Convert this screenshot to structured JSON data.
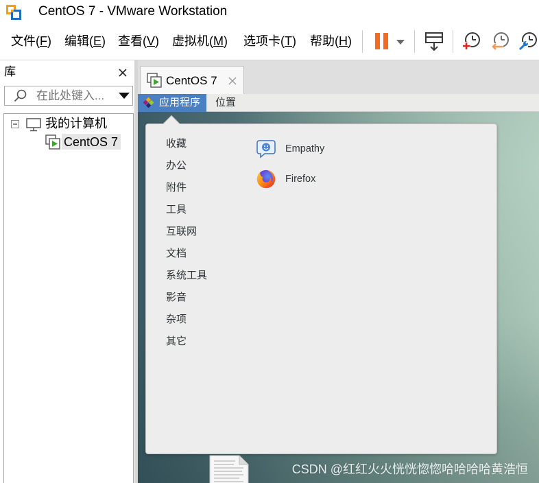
{
  "window": {
    "title": "CentOS 7 - VMware Workstation",
    "logo_icon": "vmware-workstation-logo-icon"
  },
  "menubar": {
    "items": [
      "文件(F)",
      "编辑(E)",
      "查看(V)",
      "虚拟机(M)",
      "选项卡(T)",
      "帮助(H)"
    ]
  },
  "toolbar": {
    "buttons": [
      {
        "icon": "pause-icon",
        "color": "#f26b21"
      },
      {
        "icon": "chevron-down-icon"
      },
      {
        "icon": "send-ctrl-alt-del-icon"
      },
      {
        "icon": "take-snapshot-icon"
      },
      {
        "icon": "revert-snapshot-icon"
      },
      {
        "icon": "snapshot-manager-icon"
      }
    ]
  },
  "library": {
    "title": "库",
    "close_icon": "close-icon",
    "search": {
      "placeholder": "在此处键入...",
      "value": ""
    },
    "tree": {
      "root": {
        "label": "我的计算机",
        "icon": "computer-icon",
        "expanded": true
      },
      "children": [
        {
          "label": "CentOS 7",
          "icon": "virtual-machine-icon",
          "selected": true
        }
      ]
    }
  },
  "tabs": [
    {
      "label": "CentOS 7",
      "icon": "virtual-machine-icon",
      "active": true
    }
  ],
  "guest": {
    "topbar": {
      "applications": "应用程序",
      "places": "位置",
      "applications_active": true
    },
    "app_menu": {
      "categories": [
        "收藏",
        "办公",
        "附件",
        "工具",
        "互联网",
        "文档",
        "系统工具",
        "影音",
        "杂项",
        "其它"
      ],
      "apps": [
        {
          "name": "Empathy",
          "icon": "empathy-icon"
        },
        {
          "name": "Firefox",
          "icon": "firefox-icon"
        }
      ]
    },
    "desktop_icons": [
      {
        "icon": "document-icon"
      }
    ]
  },
  "watermark": {
    "text": "CSDN @红红火火恍恍惚惚哈哈哈哈黄浩恒"
  },
  "colors": {
    "accent": "#4a7fc1",
    "pause": "#f26b21",
    "play": "#3fa52e",
    "vmware_orange": "#f59c1a",
    "vmware_blue": "#1e6fb5"
  }
}
